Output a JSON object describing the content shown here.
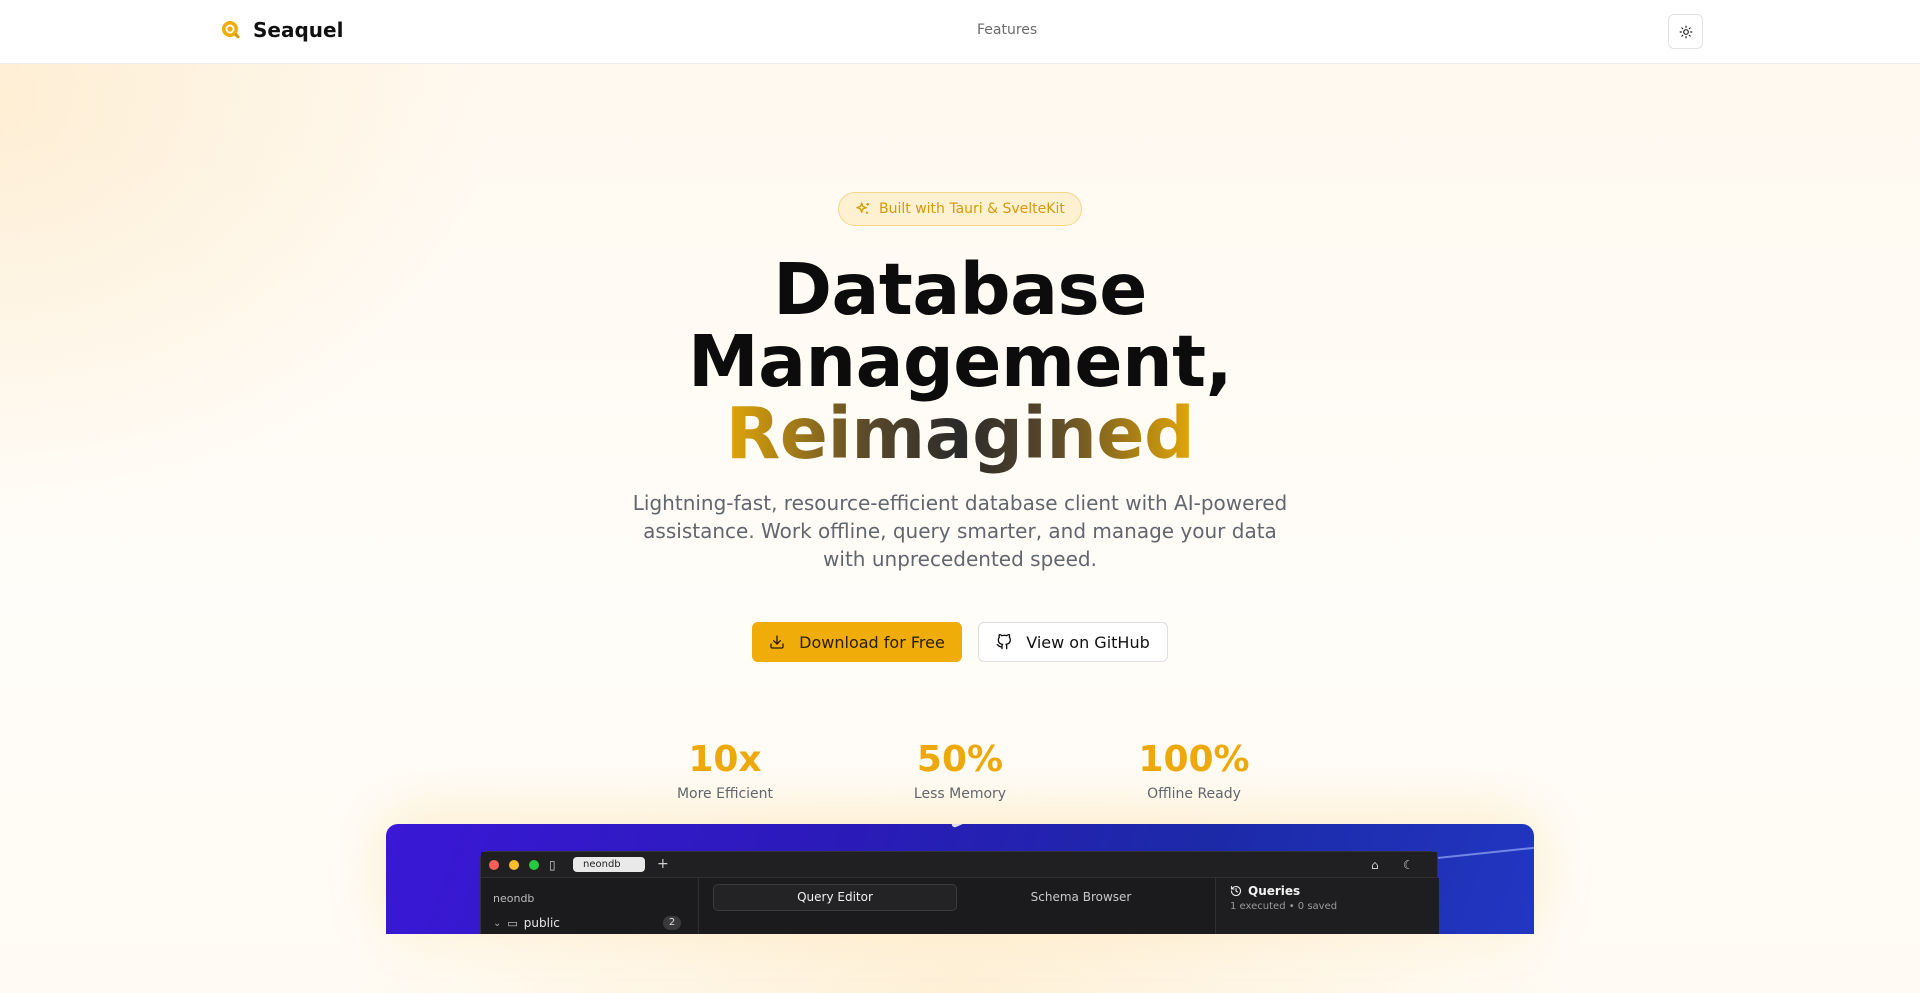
{
  "header": {
    "brand_name": "Seaquel",
    "nav": [
      "Features"
    ],
    "theme_toggle_icon": "sun-icon"
  },
  "hero": {
    "badge_icon": "sparkles-icon",
    "badge_text": "Built with Tauri & SvelteKit",
    "title_line1": "Database",
    "title_line2": "Management,",
    "title_accent": "Reimagined",
    "subtitle": "Lightning-fast, resource-efficient database client with AI-powered assistance. Work offline, query smarter, and manage your data with unprecedented speed.",
    "primary_button": "Download for Free",
    "primary_button_icon": "download-icon",
    "secondary_button": "View on GitHub",
    "secondary_button_icon": "github-icon"
  },
  "stats": [
    {
      "value": "10x",
      "label": "More Efficient"
    },
    {
      "value": "50%",
      "label": "Less Memory"
    },
    {
      "value": "100%",
      "label": "Offline Ready"
    }
  ],
  "app_preview": {
    "connection_tab": "neondb",
    "sidebar_database": "neondb",
    "sidebar_schema": "public",
    "sidebar_schema_count": "2",
    "tabs": [
      "Query Editor",
      "Schema Browser"
    ],
    "active_tab": "Query Editor",
    "panel_title": "Queries",
    "panel_subtitle": "1 executed • 0 saved"
  },
  "colors": {
    "accent": "#f0ad0a",
    "badge_bg": "#fdf1d2",
    "text_muted": "#62666d",
    "preview_bg": "#2a1bb8"
  }
}
